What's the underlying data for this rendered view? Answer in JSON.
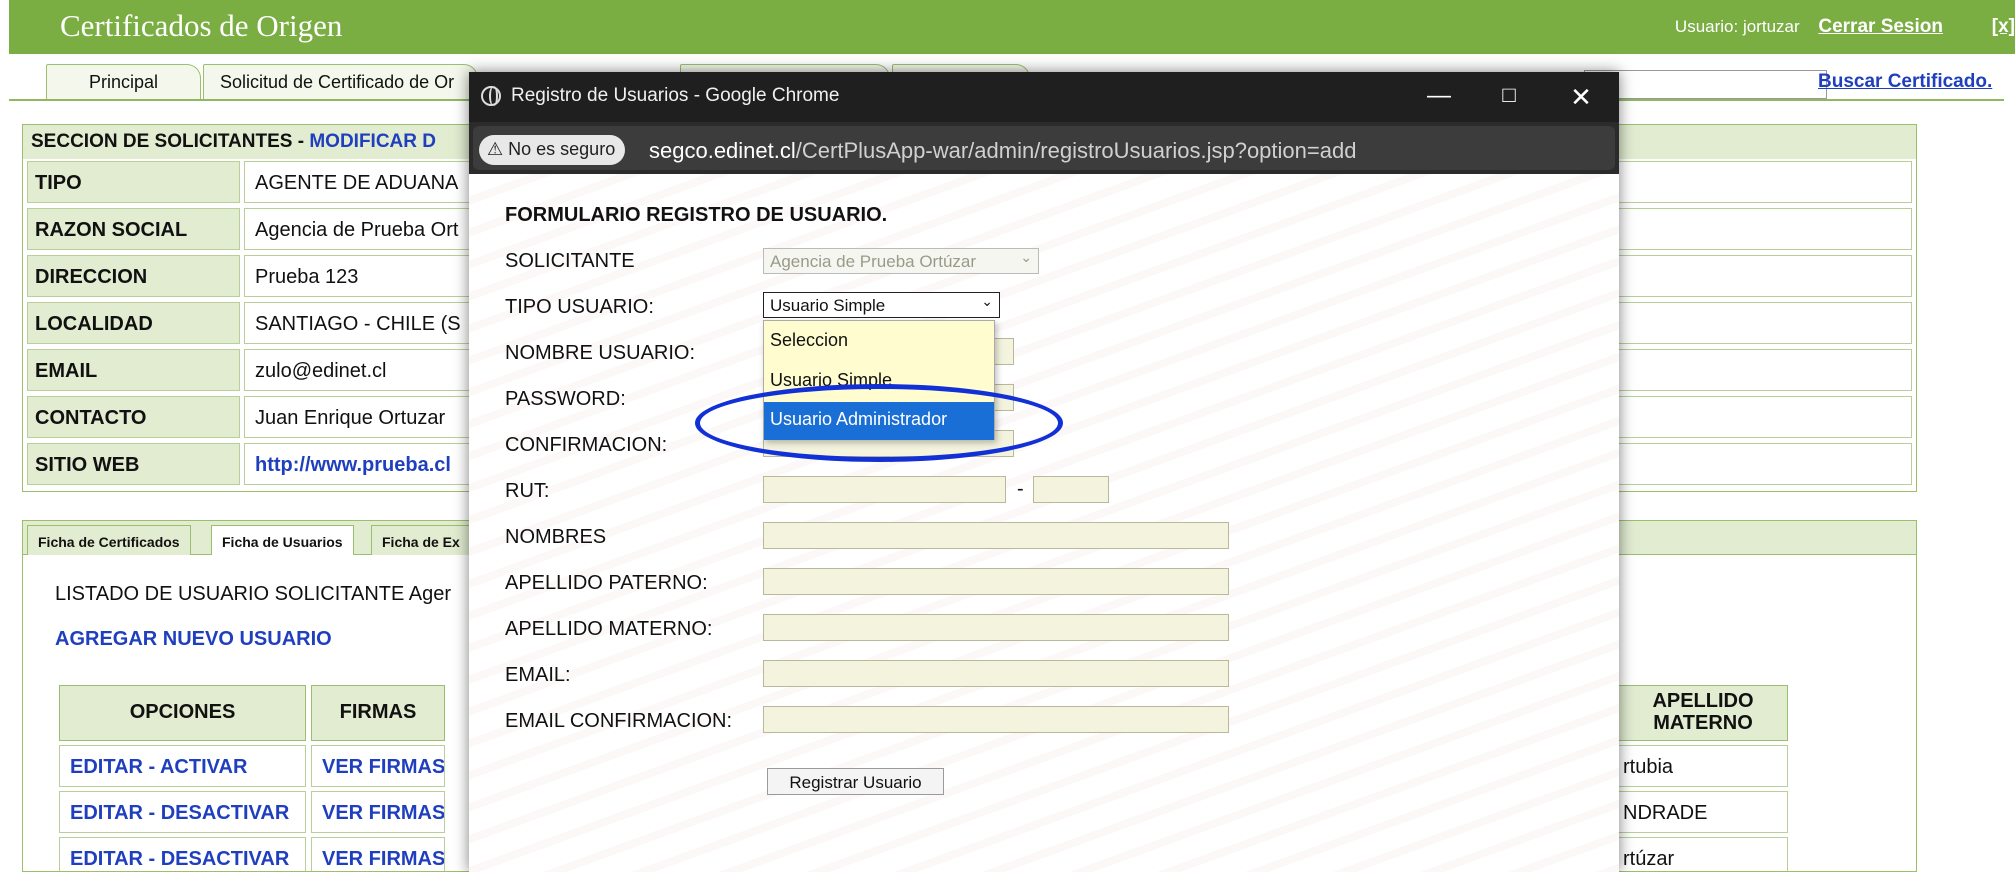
{
  "header": {
    "app_title": "Certificados de Origen",
    "user_label": "Usuario: jortuzar",
    "logout": "Cerrar Sesion",
    "close": "[x]"
  },
  "main_tabs": [
    "Principal",
    "Solicitud de Certificado de Or"
  ],
  "search": {
    "link": "Buscar Certificado."
  },
  "solicitantes": {
    "title_prefix": "SECCION DE SOLICITANTES - ",
    "title_action": "MODIFICAR D",
    "rows": [
      {
        "label": "TIPO",
        "value": "AGENTE DE ADUANA"
      },
      {
        "label": "RAZON SOCIAL",
        "value": "Agencia de Prueba Ort"
      },
      {
        "label": "DIRECCION",
        "value": "Prueba 123"
      },
      {
        "label": "LOCALIDAD",
        "value": "SANTIAGO - CHILE (S"
      },
      {
        "label": "EMAIL",
        "value": "zulo@edinet.cl"
      },
      {
        "label": "CONTACTO",
        "value": "Juan Enrique Ortuzar"
      },
      {
        "label": "SITIO WEB",
        "value": "http://www.prueba.cl"
      }
    ]
  },
  "lower": {
    "tabs": [
      "Ficha de Certificados",
      "Ficha de Usuarios",
      "Ficha de Ex"
    ],
    "list_title": "LISTADO DE USUARIO SOLICITANTE Ager",
    "add_user": "AGREGAR NUEVO USUARIO",
    "headers": [
      "OPCIONES",
      "FIRMAS",
      "APELLIDO MATERNO"
    ],
    "rows": [
      {
        "option": "EDITAR - ACTIVAR",
        "firmas": "VER FIRMAS",
        "materno": "rtubia"
      },
      {
        "option": "EDITAR - DESACTIVAR",
        "firmas": "VER FIRMAS",
        "materno": "NDRADE"
      },
      {
        "option": "EDITAR - DESACTIVAR",
        "firmas": "VER FIRMAS",
        "materno": "rtúzar"
      }
    ]
  },
  "popup": {
    "window_title": "Registro de Usuarios - Google Chrome",
    "security": "No es seguro",
    "url_host": "segco.edinet.cl",
    "url_path": "/CertPlusApp-war/admin/registroUsuarios.jsp?option=add",
    "form_title": "FORMULARIO REGISTRO DE USUARIO.",
    "labels": {
      "solicitante": "SOLICITANTE",
      "tipo": "TIPO USUARIO:",
      "nombre": "NOMBRE USUARIO:",
      "password": "PASSWORD:",
      "confirmacion": "CONFIRMACION:",
      "rut": "RUT:",
      "nombres": "NOMBRES",
      "paterno": "APELLIDO PATERNO:",
      "materno": "APELLIDO MATERNO:",
      "email": "EMAIL:",
      "email_conf": "EMAIL CONFIRMACION:"
    },
    "solicitante_value": "Agencia de Prueba Ortúzar",
    "tipo_value": "Usuario Simple",
    "tipo_options": [
      "Seleccion",
      "Usuario Simple",
      "Usuario Administrador"
    ],
    "rut_sep": "-",
    "submit": "Registrar Usuario"
  }
}
